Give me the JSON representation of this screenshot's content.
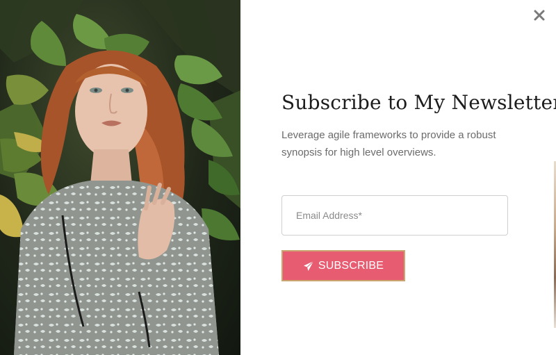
{
  "modal": {
    "title": "Subscribe to My Newsletter",
    "description": "Leverage agile frameworks to provide a robust synopsis for high level overviews.",
    "email_placeholder": "Email Address*",
    "subscribe_label": "SUBSCRIBE",
    "subscribe_icon": "paper-plane-icon",
    "close_icon": "close-icon",
    "colors": {
      "button_bg": "#e85c72",
      "button_border": "#c9a56f",
      "title": "#1c1c1c",
      "description": "#6b6b6b"
    }
  }
}
